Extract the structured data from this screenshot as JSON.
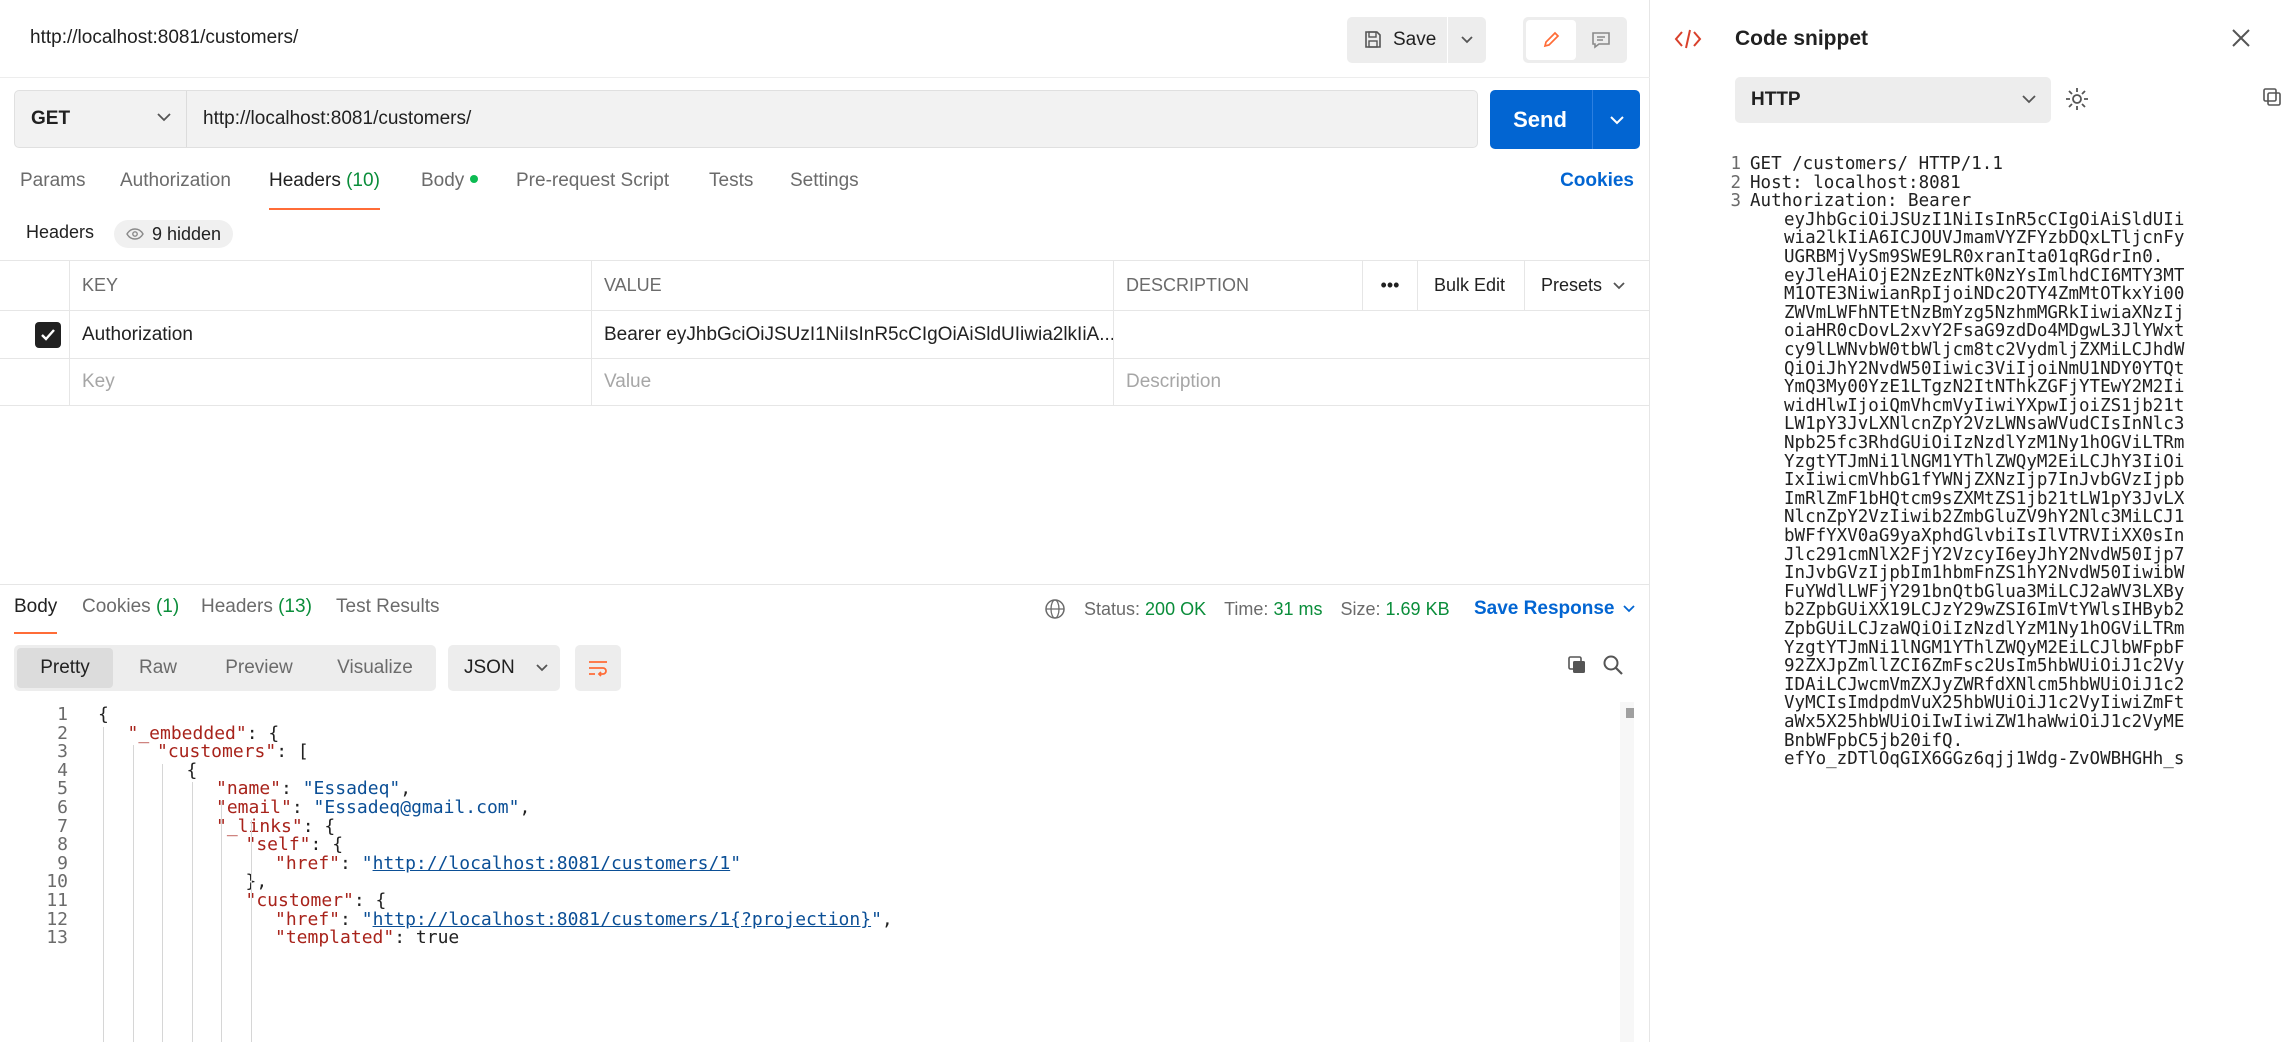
{
  "request": {
    "title": "http://localhost:8081/customers/",
    "save_label": "Save",
    "method": "GET",
    "url": "http://localhost:8081/customers/",
    "send_label": "Send",
    "tabs": [
      {
        "label": "Params",
        "count": ""
      },
      {
        "label": "Authorization",
        "count": ""
      },
      {
        "label": "Headers",
        "count": "(10)"
      },
      {
        "label": "Body",
        "count": ""
      },
      {
        "label": "Pre-request Script",
        "count": ""
      },
      {
        "label": "Tests",
        "count": ""
      },
      {
        "label": "Settings",
        "count": ""
      }
    ],
    "cookies_label": "Cookies",
    "headers_sub_label": "Headers",
    "hidden_label": "9 hidden",
    "table": {
      "col_key": "KEY",
      "col_value": "VALUE",
      "col_description": "DESCRIPTION",
      "more": "•••",
      "bulk_edit": "Bulk Edit",
      "presets": "Presets",
      "rows": [
        {
          "key": "Authorization",
          "value": "Bearer eyJhbGciOiJSUzI1NiIsInR5cCIgOiAiSldUIiwia2lkIiA...",
          "description": ""
        }
      ],
      "placeholder_key": "Key",
      "placeholder_value": "Value",
      "placeholder_description": "Description"
    }
  },
  "response": {
    "tabs": [
      {
        "label": "Body",
        "count": ""
      },
      {
        "label": "Cookies",
        "count": "(1)"
      },
      {
        "label": "Headers",
        "count": "(13)"
      },
      {
        "label": "Test Results",
        "count": ""
      }
    ],
    "status_label": "Status:",
    "status_value": "200 OK",
    "time_label": "Time:",
    "time_value": "31 ms",
    "size_label": "Size:",
    "size_value": "1.69 KB",
    "save_response_label": "Save Response",
    "views": [
      "Pretty",
      "Raw",
      "Preview",
      "Visualize"
    ],
    "format": "JSON",
    "lines": [
      {
        "n": "1",
        "indent": 0,
        "parts": [
          [
            "p",
            "{"
          ]
        ]
      },
      {
        "n": "2",
        "indent": 1,
        "parts": [
          [
            "k",
            "\"_embedded\""
          ],
          [
            "p",
            ": {"
          ]
        ]
      },
      {
        "n": "3",
        "indent": 2,
        "parts": [
          [
            "k",
            "\"customers\""
          ],
          [
            "p",
            ": ["
          ]
        ]
      },
      {
        "n": "4",
        "indent": 3,
        "parts": [
          [
            "p",
            "{"
          ]
        ]
      },
      {
        "n": "5",
        "indent": 4,
        "parts": [
          [
            "k",
            "\"name\""
          ],
          [
            "p",
            ": "
          ],
          [
            "s",
            "\"Essadeq\""
          ],
          [
            "p",
            ","
          ]
        ]
      },
      {
        "n": "6",
        "indent": 4,
        "parts": [
          [
            "k",
            "\"email\""
          ],
          [
            "p",
            ": "
          ],
          [
            "s",
            "\"Essadeq@gmail.com\""
          ],
          [
            "p",
            ","
          ]
        ]
      },
      {
        "n": "7",
        "indent": 4,
        "parts": [
          [
            "k",
            "\"_links\""
          ],
          [
            "p",
            ": {"
          ]
        ]
      },
      {
        "n": "8",
        "indent": 5,
        "parts": [
          [
            "k",
            "\"self\""
          ],
          [
            "p",
            ": {"
          ]
        ]
      },
      {
        "n": "9",
        "indent": 6,
        "parts": [
          [
            "k",
            "\"href\""
          ],
          [
            "p",
            ": "
          ],
          [
            "s",
            "\""
          ],
          [
            "u",
            "http://localhost:8081/customers/1"
          ],
          [
            "s",
            "\""
          ]
        ]
      },
      {
        "n": "10",
        "indent": 5,
        "parts": [
          [
            "p",
            "},"
          ]
        ]
      },
      {
        "n": "11",
        "indent": 5,
        "parts": [
          [
            "k",
            "\"customer\""
          ],
          [
            "p",
            ": {"
          ]
        ]
      },
      {
        "n": "12",
        "indent": 6,
        "parts": [
          [
            "k",
            "\"href\""
          ],
          [
            "p",
            ": "
          ],
          [
            "s",
            "\""
          ],
          [
            "u",
            "http://localhost:8081/customers/1{?projection}"
          ],
          [
            "s",
            "\""
          ],
          [
            "p",
            ","
          ]
        ]
      },
      {
        "n": "13",
        "indent": 6,
        "parts": [
          [
            "k",
            "\"templated\""
          ],
          [
            "p",
            ": true"
          ]
        ]
      }
    ]
  },
  "snippet": {
    "title": "Code snippet",
    "language": "HTTP",
    "lines": [
      {
        "n": "1",
        "text": "GET /customers/ HTTP/1.1",
        "wrap": false
      },
      {
        "n": "2",
        "text": "Host: localhost:8081",
        "wrap": false
      },
      {
        "n": "3",
        "text": "Authorization: Bearer",
        "wrap": false
      },
      {
        "n": "",
        "text": "eyJhbGciOiJSUzI1NiIsInR5cCIgOiAiSldUIi",
        "wrap": true
      },
      {
        "n": "",
        "text": "wia2lkIiA6ICJOUVJmamVYZFYzbDQxLTljcnFy",
        "wrap": true
      },
      {
        "n": "",
        "text": "UGRBMjVySm9SWE9LR0xranIta01qRGdrIn0.",
        "wrap": true
      },
      {
        "n": "",
        "text": "eyJleHAiOjE2NzEzNTk0NzYsImlhdCI6MTY3MT",
        "wrap": true
      },
      {
        "n": "",
        "text": "M1OTE3NiwianRpIjoiNDc2OTY4ZmMtOTkxYi00",
        "wrap": true
      },
      {
        "n": "",
        "text": "ZWVmLWFhNTEtNzBmYzg5NzhmMGRkIiwiaXNzIj",
        "wrap": true
      },
      {
        "n": "",
        "text": "oiaHR0cDovL2xvY2FsaG9zdDo4MDgwL3JlYWxt",
        "wrap": true
      },
      {
        "n": "",
        "text": "cy9lLWNvbW0tbWljcm8tc2VydmljZXMiLCJhdW",
        "wrap": true
      },
      {
        "n": "",
        "text": "QiOiJhY2NvdW50Iiwic3ViIjoiNmU1NDY0YTQt",
        "wrap": true
      },
      {
        "n": "",
        "text": "YmQ3My00YzE1LTgzN2ItNThkZGFjYTEwY2M2Ii",
        "wrap": true
      },
      {
        "n": "",
        "text": "widHlwIjoiQmVhcmVyIiwiYXpwIjoiZS1jb21t",
        "wrap": true
      },
      {
        "n": "",
        "text": "LW1pY3JvLXNlcnZpY2VzLWNsaWVudCIsInNlc3",
        "wrap": true
      },
      {
        "n": "",
        "text": "Npb25fc3RhdGUiOiIzNzdlYzM1Ny1hOGViLTRm",
        "wrap": true
      },
      {
        "n": "",
        "text": "YzgtYTJmNi1lNGM1YThlZWQyM2EiLCJhY3IiOi",
        "wrap": true
      },
      {
        "n": "",
        "text": "IxIiwicmVhbG1fYWNjZXNzIjp7InJvbGVzIjpb",
        "wrap": true
      },
      {
        "n": "",
        "text": "ImRlZmF1bHQtcm9sZXMtZS1jb21tLW1pY3JvLX",
        "wrap": true
      },
      {
        "n": "",
        "text": "NlcnZpY2VzIiwib2ZmbGluZV9hY2Nlc3MiLCJ1",
        "wrap": true
      },
      {
        "n": "",
        "text": "bWFfYXV0aG9yaXphdGlvbiIsIlVTRVIiXX0sIn",
        "wrap": true
      },
      {
        "n": "",
        "text": "Jlc291cmNlX2FjY2VzcyI6eyJhY2NvdW50Ijp7",
        "wrap": true
      },
      {
        "n": "",
        "text": "InJvbGVzIjpbIm1hbmFnZS1hY2NvdW50IiwibW",
        "wrap": true
      },
      {
        "n": "",
        "text": "FuYWdlLWFjY291bnQtbGlua3MiLCJ2aWV3LXBy",
        "wrap": true
      },
      {
        "n": "",
        "text": "b2ZpbGUiXX19LCJzY29wZSI6ImVtYWlsIHByb2",
        "wrap": true
      },
      {
        "n": "",
        "text": "ZpbGUiLCJzaWQiOiIzNzdlYzM1Ny1hOGViLTRm",
        "wrap": true
      },
      {
        "n": "",
        "text": "YzgtYTJmNi1lNGM1YThlZWQyM2EiLCJlbWFpbF",
        "wrap": true
      },
      {
        "n": "",
        "text": "92ZXJpZmllZCI6ZmFsc2UsIm5hbWUiOiJ1c2Vy",
        "wrap": true
      },
      {
        "n": "",
        "text": "IDAiLCJwcmVmZXJyZWRfdXNlcm5hbWUiOiJ1c2",
        "wrap": true
      },
      {
        "n": "",
        "text": "VyMCIsImdpdmVuX25hbWUiOiJ1c2VyIiwiZmFt",
        "wrap": true
      },
      {
        "n": "",
        "text": "aWx5X25hbWUiOiIwIiwiZW1haWwiOiJ1c2VyME",
        "wrap": true
      },
      {
        "n": "",
        "text": "BnbWFpbC5jb20ifQ.",
        "wrap": true
      },
      {
        "n": "",
        "text": "efYo_zDTlOqGIX6GGz6qjj1Wdg-ZvOWBHGHh_s",
        "wrap": true
      }
    ]
  },
  "icons": {
    "save": "save-icon",
    "edit": "pencil-icon",
    "comment": "comment-icon",
    "eye": "eye-icon",
    "globe": "globe-icon",
    "wrap": "wrap-lines-icon",
    "copy": "copy-icon",
    "search": "search-icon",
    "code": "code-icon",
    "close": "close-icon",
    "gear": "gear-icon"
  },
  "colors": {
    "accent": "#ff6c37",
    "send": "#0265d2",
    "status_ok": "#0a8d3a"
  }
}
